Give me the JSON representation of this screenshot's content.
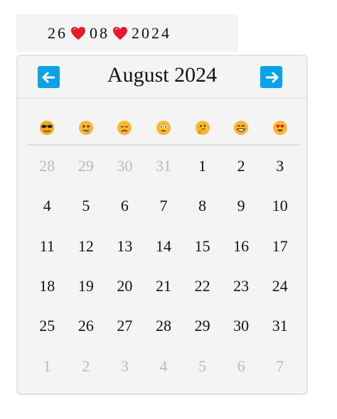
{
  "date_input": {
    "day": "26",
    "month": "08",
    "year": "2024",
    "separator_icon": "heart-icon"
  },
  "calendar": {
    "title": "August 2024",
    "prev_icon": "arrow-left-icon",
    "next_icon": "arrow-right-icon",
    "weekday_icons": [
      "sunglasses-face-icon",
      "drooling-face-icon",
      "disappointed-face-icon",
      "flushed-face-icon",
      "thinking-face-icon",
      "grinning-face-icon",
      "heart-eyes-face-icon"
    ],
    "days": [
      {
        "n": "28",
        "muted": true
      },
      {
        "n": "29",
        "muted": true
      },
      {
        "n": "30",
        "muted": true
      },
      {
        "n": "31",
        "muted": true
      },
      {
        "n": "1"
      },
      {
        "n": "2"
      },
      {
        "n": "3"
      },
      {
        "n": "4"
      },
      {
        "n": "5"
      },
      {
        "n": "6"
      },
      {
        "n": "7"
      },
      {
        "n": "8"
      },
      {
        "n": "9"
      },
      {
        "n": "10"
      },
      {
        "n": "11"
      },
      {
        "n": "12"
      },
      {
        "n": "13"
      },
      {
        "n": "14"
      },
      {
        "n": "15"
      },
      {
        "n": "16"
      },
      {
        "n": "17"
      },
      {
        "n": "18"
      },
      {
        "n": "19"
      },
      {
        "n": "20"
      },
      {
        "n": "21"
      },
      {
        "n": "22"
      },
      {
        "n": "23"
      },
      {
        "n": "24"
      },
      {
        "n": "25"
      },
      {
        "n": "26"
      },
      {
        "n": "27"
      },
      {
        "n": "28"
      },
      {
        "n": "29"
      },
      {
        "n": "30"
      },
      {
        "n": "31"
      },
      {
        "n": "1",
        "muted": true
      },
      {
        "n": "2",
        "muted": true
      },
      {
        "n": "3",
        "muted": true
      },
      {
        "n": "4",
        "muted": true
      },
      {
        "n": "5",
        "muted": true
      },
      {
        "n": "6",
        "muted": true
      },
      {
        "n": "7",
        "muted": true
      }
    ]
  },
  "colors": {
    "accent": "#0aa2e8",
    "heart": "#e8182b",
    "muted_text": "#b9b9b9",
    "panel": "#f4f4f4"
  }
}
